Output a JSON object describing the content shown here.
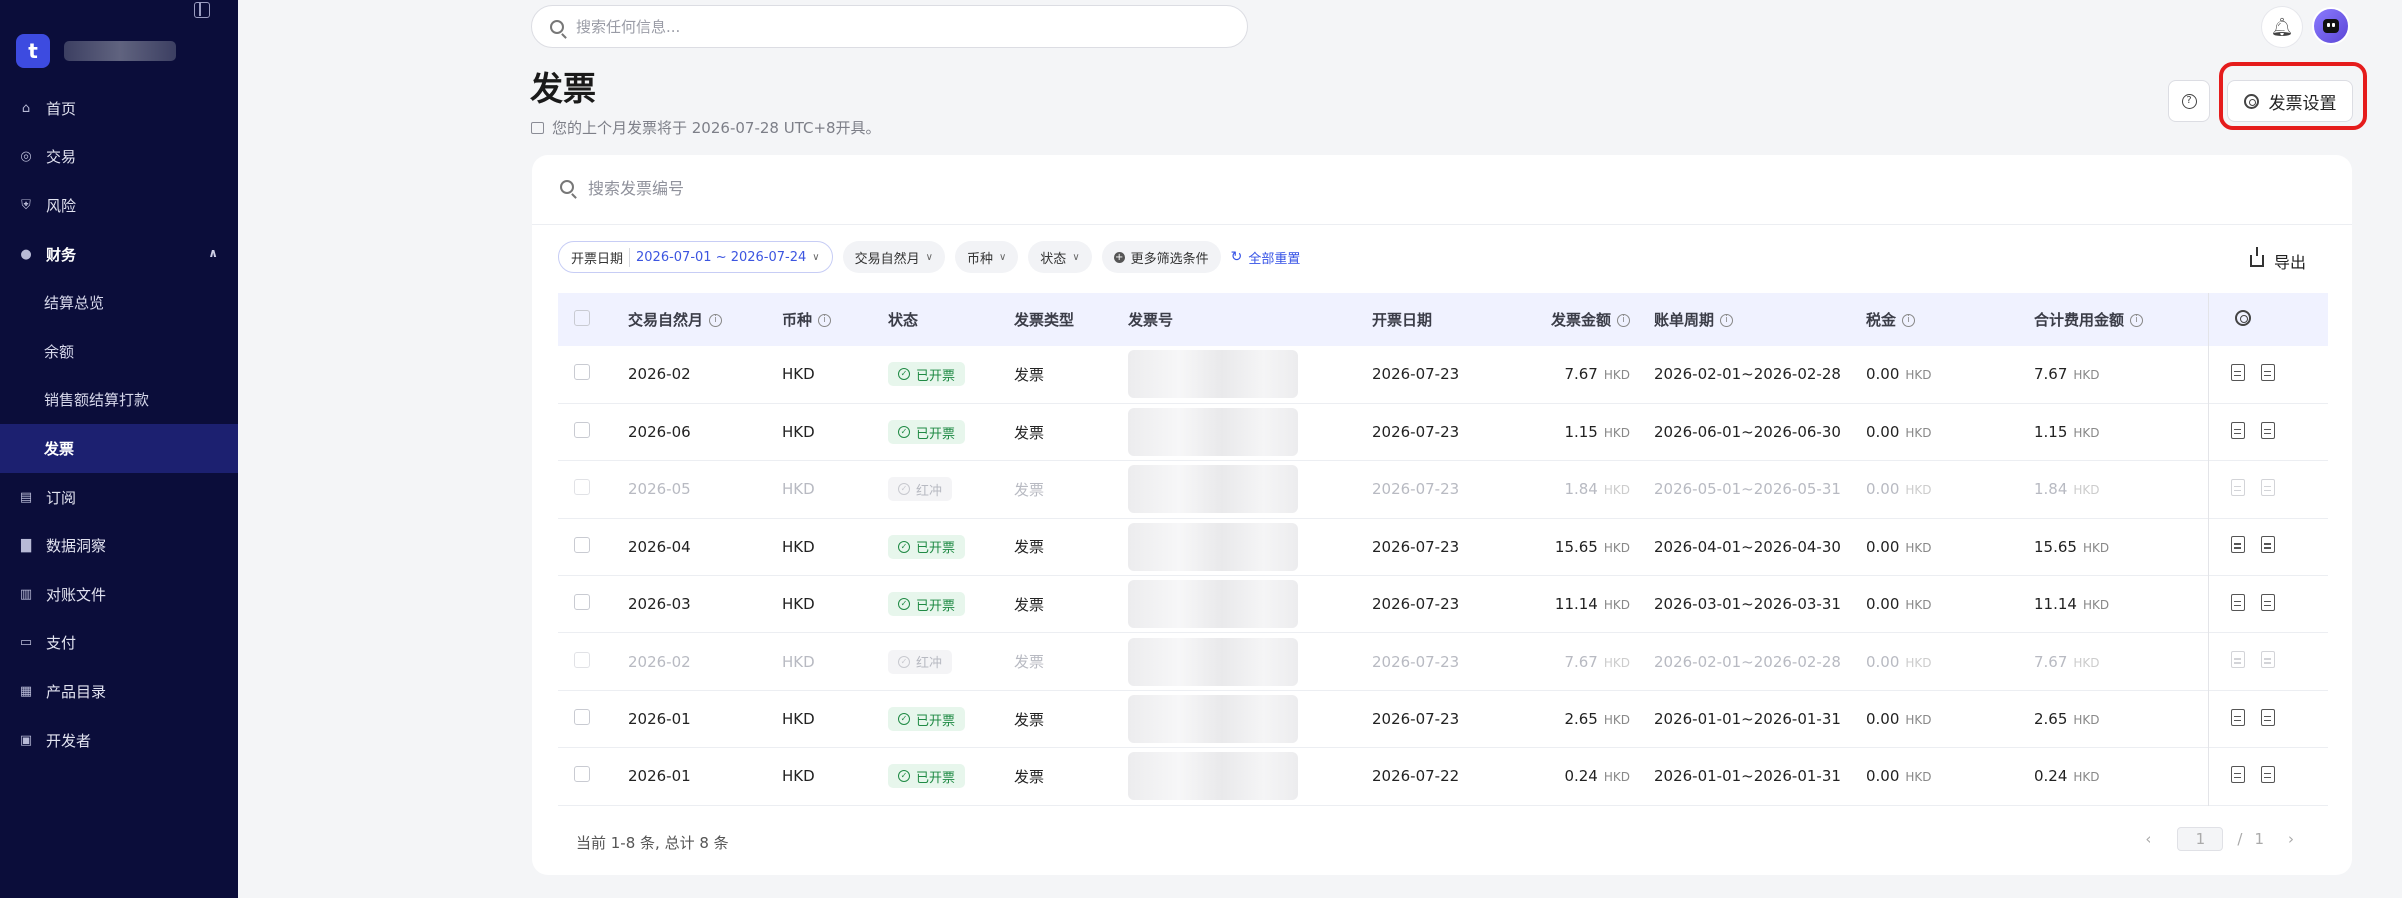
{
  "sidebar": {
    "logo_letter": "t",
    "items": [
      {
        "label": "首页",
        "icon": "home-icon"
      },
      {
        "label": "交易",
        "icon": "transactions-icon"
      },
      {
        "label": "风险",
        "icon": "shield-icon"
      },
      {
        "label": "财务",
        "icon": "money-bag-icon",
        "expanded": true,
        "children": [
          "结算总览",
          "余额",
          "销售额结算打款",
          "发票"
        ]
      },
      {
        "label": "订阅",
        "icon": "subscription-icon"
      },
      {
        "label": "数据洞察",
        "icon": "chart-icon"
      },
      {
        "label": "对账文件",
        "icon": "file-icon"
      },
      {
        "label": "支付",
        "icon": "payment-icon"
      },
      {
        "label": "产品目录",
        "icon": "grid-icon"
      },
      {
        "label": "开发者",
        "icon": "terminal-icon"
      }
    ],
    "active_child": "发票"
  },
  "topbar": {
    "search_placeholder": "搜索任何信息..."
  },
  "page": {
    "title": "发票",
    "subtitle": "您的上个月发票将于 2026-07-28 UTC+8开具。",
    "settings_label": "发票设置"
  },
  "filters": {
    "search_placeholder": "搜索发票编号",
    "date_label": "开票日期",
    "date_value": "2026-07-01 ~ 2026-07-24",
    "month_label": "交易自然月",
    "currency_label": "币种",
    "status_label": "状态",
    "more_label": "更多筛选条件",
    "reset_label": "全部重置",
    "export_label": "导出"
  },
  "table": {
    "headers": [
      "交易自然月",
      "币种",
      "状态",
      "发票类型",
      "发票号",
      "开票日期",
      "发票金额",
      "账单周期",
      "税金",
      "合计费用金额"
    ],
    "rows": [
      {
        "month": "2026-02",
        "currency": "HKD",
        "status": "已开票",
        "type": "发票",
        "date": "2026-07-23",
        "amount": "7.67",
        "unit": "HKD",
        "period": "2026-02-01~2026-02-28",
        "tax": "0.00",
        "total": "7.67",
        "dim": false
      },
      {
        "month": "2026-06",
        "currency": "HKD",
        "status": "已开票",
        "type": "发票",
        "date": "2026-07-23",
        "amount": "1.15",
        "unit": "HKD",
        "period": "2026-06-01~2026-06-30",
        "tax": "0.00",
        "total": "1.15",
        "dim": false
      },
      {
        "month": "2026-05",
        "currency": "HKD",
        "status": "红冲",
        "type": "发票",
        "date": "2026-07-23",
        "amount": "1.84",
        "unit": "HKD",
        "period": "2026-05-01~2026-05-31",
        "tax": "0.00",
        "total": "1.84",
        "dim": true
      },
      {
        "month": "2026-04",
        "currency": "HKD",
        "status": "已开票",
        "type": "发票",
        "date": "2026-07-23",
        "amount": "15.65",
        "unit": "HKD",
        "period": "2026-04-01~2026-04-30",
        "tax": "0.00",
        "total": "15.65",
        "dim": false
      },
      {
        "month": "2026-03",
        "currency": "HKD",
        "status": "已开票",
        "type": "发票",
        "date": "2026-07-23",
        "amount": "11.14",
        "unit": "HKD",
        "period": "2026-03-01~2026-03-31",
        "tax": "0.00",
        "total": "11.14",
        "dim": false
      },
      {
        "month": "2026-02",
        "currency": "HKD",
        "status": "红冲",
        "type": "发票",
        "date": "2026-07-23",
        "amount": "7.67",
        "unit": "HKD",
        "period": "2026-02-01~2026-02-28",
        "tax": "0.00",
        "total": "7.67",
        "dim": true
      },
      {
        "month": "2026-01",
        "currency": "HKD",
        "status": "已开票",
        "type": "发票",
        "date": "2026-07-23",
        "amount": "2.65",
        "unit": "HKD",
        "period": "2026-01-01~2026-01-31",
        "tax": "0.00",
        "total": "2.65",
        "dim": false
      },
      {
        "month": "2026-01",
        "currency": "HKD",
        "status": "已开票",
        "type": "发票",
        "date": "2026-07-22",
        "amount": "0.24",
        "unit": "HKD",
        "period": "2026-01-01~2026-01-31",
        "tax": "0.00",
        "total": "0.24",
        "dim": false
      }
    ]
  },
  "footer": {
    "count_text": "当前 1-8 条, 总计 8 条",
    "page": "1",
    "page_sep": "/",
    "total_pages": "1"
  }
}
